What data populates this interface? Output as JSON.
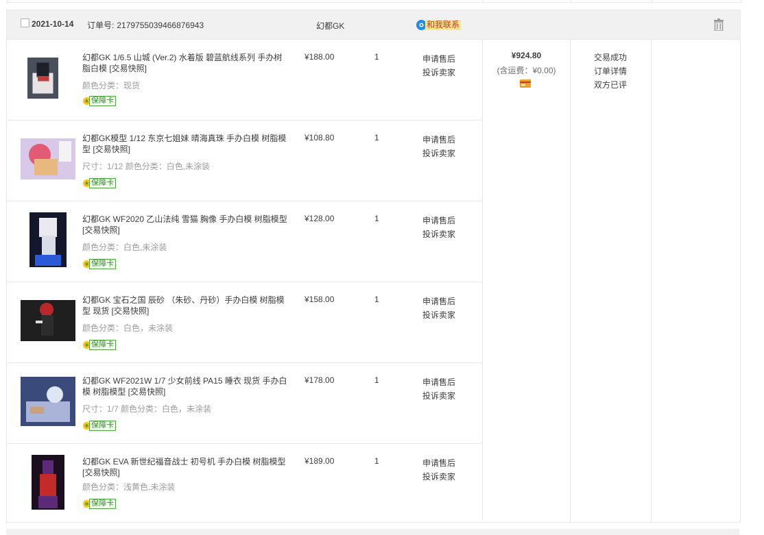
{
  "order": {
    "date": "2021-10-14",
    "order_no_label": "订单号:",
    "order_no": "2179755039466876943",
    "shop_name": "幻都GK",
    "contact_label": "和我联系",
    "total": "¥924.80",
    "shipping": "(含运费：¥0.00)",
    "status": "交易成功",
    "detail_link": "订单详情",
    "review_status": "双方已评",
    "items": [
      {
        "title": "幻都GK 1/6.5 山城 (Ver.2) 水着版 碧蓝航线系列 手办树脂白模 [交易快照]",
        "sku": "颜色分类：现货",
        "guarantee": "保障卡",
        "price": "¥188.00",
        "qty": "1",
        "after_sale": "申请售后",
        "complain": "投诉卖家"
      },
      {
        "title": "幻都GK模型 1/12 东京七姐妹 晴海真珠 手办白模 树脂模型 [交易快照]",
        "sku": "尺寸：1/12  颜色分类：白色,未涂装",
        "guarantee": "保障卡",
        "price": "¥108.80",
        "qty": "1",
        "after_sale": "申请售后",
        "complain": "投诉卖家"
      },
      {
        "title": "幻都GK WF2020 乙山法纯 雪猫 胸像 手办白模 树脂模型 [交易快照]",
        "sku": "颜色分类：白色,未涂装",
        "guarantee": "保障卡",
        "price": "¥128.00",
        "qty": "1",
        "after_sale": "申请售后",
        "complain": "投诉卖家"
      },
      {
        "title": "幻都GK 宝石之国 辰砂 （朱砂、丹砂）手办白模 树脂模型 现货 [交易快照]",
        "sku": "颜色分类：白色，未涂装",
        "guarantee": "保障卡",
        "price": "¥158.00",
        "qty": "1",
        "after_sale": "申请售后",
        "complain": "投诉卖家"
      },
      {
        "title": "幻都GK WF2021W 1/7 少女前线 PA15 睡衣 现货 手办白模 树脂模型 [交易快照]",
        "sku": "尺寸：1/7  颜色分类：白色，未涂装",
        "guarantee": "保障卡",
        "price": "¥178.00",
        "qty": "1",
        "after_sale": "申请售后",
        "complain": "投诉卖家"
      },
      {
        "title": "幻都GK EVA 新世纪福音战士 初号机 手办白模 树脂模型 [交易快照]",
        "sku": "颜色分类：浅黄色,未涂装",
        "guarantee": "保障卡",
        "price": "¥189.00",
        "qty": "1",
        "after_sale": "申请售后",
        "complain": "投诉卖家"
      }
    ]
  },
  "icons": {
    "checkbox": "checkbox-icon",
    "wangwang": "wangwang-chat-icon",
    "trash": "trash-icon",
    "guarantee": "guarantee-flower-icon",
    "payment": "payment-card-icon"
  },
  "colors": {
    "header_bg": "#f1f1f1",
    "border": "#e8e8e8",
    "contact_bg": "#fce68b",
    "contact_text": "#c0392b",
    "wangwang_blue": "#1e8ee9",
    "guarantee_green": "#4fa63d",
    "muted_text": "#9c9c9c"
  }
}
